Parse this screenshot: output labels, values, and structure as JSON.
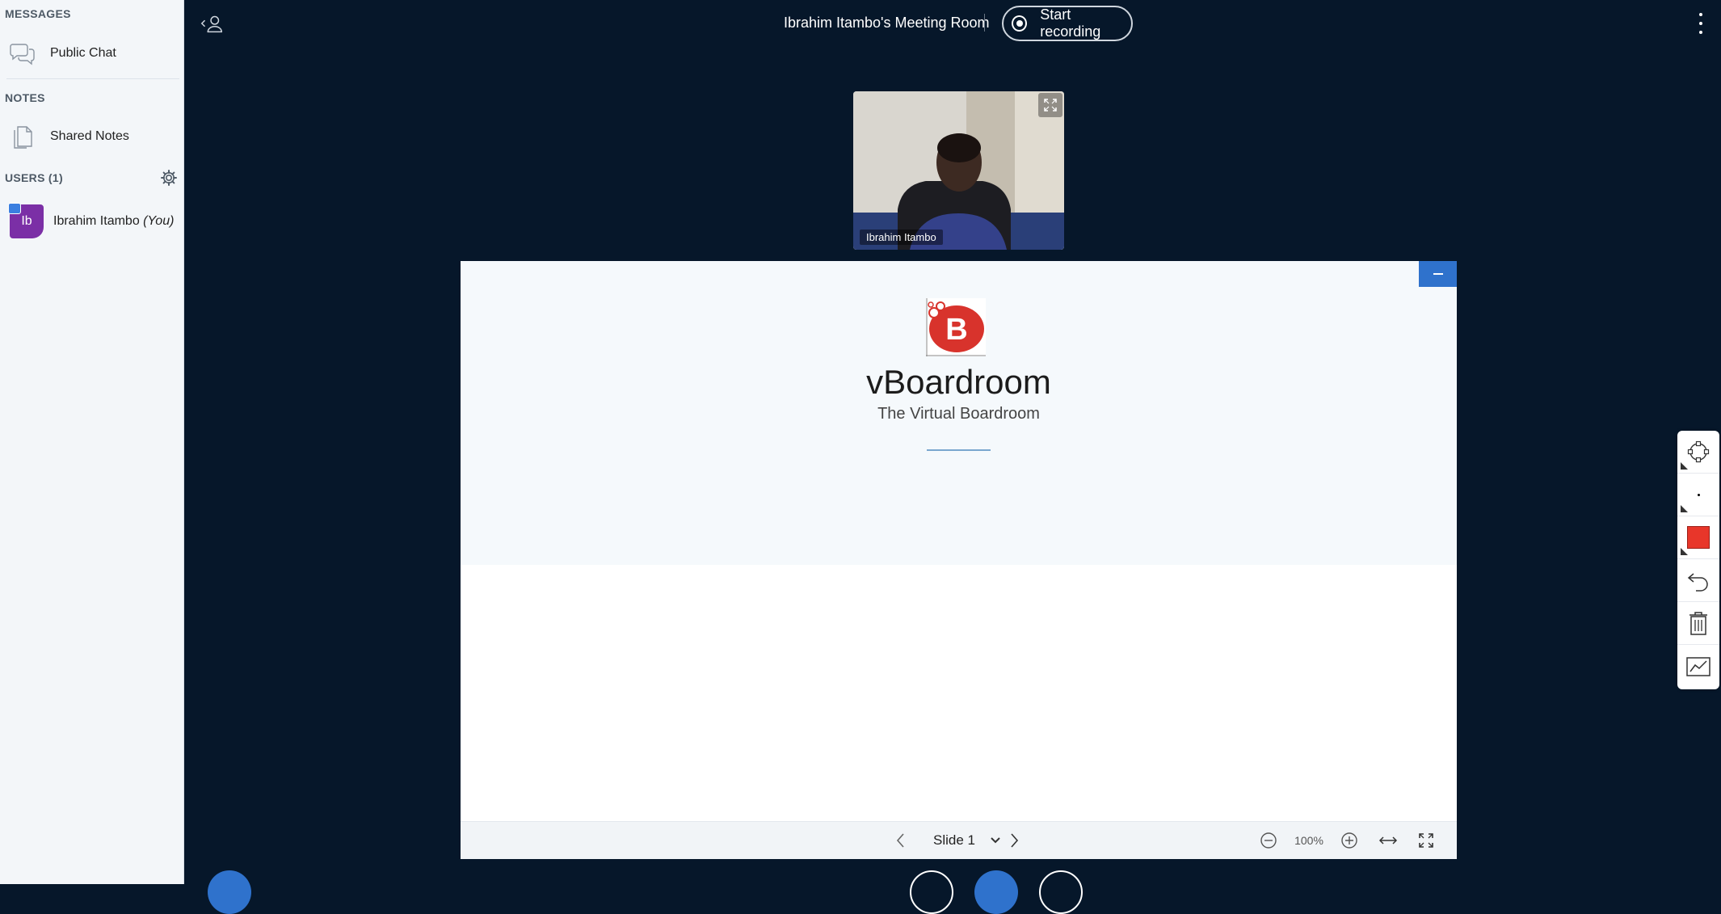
{
  "sidebar": {
    "messages_title": "MESSAGES",
    "public_chat": "Public Chat",
    "notes_title": "NOTES",
    "shared_notes": "Shared Notes",
    "users_title": "USERS (1)",
    "user": {
      "initials": "Ib",
      "name": "Ibrahim Itambo",
      "you": "(You)",
      "avatar_color": "#7b2fa6"
    }
  },
  "topbar": {
    "room_title": "Ibrahim Itambo's Meeting Room",
    "record_label": "Start recording"
  },
  "webcam": {
    "name": "Ibrahim Itambo"
  },
  "slide": {
    "title": "vBoardroom",
    "subtitle": "The Virtual Boardroom",
    "logo_letter": "B",
    "slide_label": "Slide 1",
    "zoom": "100%"
  },
  "toolbar": {
    "color": "#e8362a",
    "tools": [
      "select-tool-icon",
      "thickness-icon",
      "color-icon",
      "undo-icon",
      "trash-icon",
      "multi-user-icon"
    ]
  },
  "colors": {
    "background": "#06172a",
    "accent": "#2f72cc"
  }
}
